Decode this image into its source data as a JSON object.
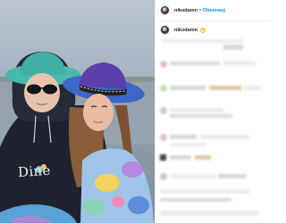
{
  "header": {
    "username": "nikodamn",
    "separator": "•",
    "follow_label": "Obserwuj"
  },
  "caption": {
    "username": "nikodamn"
  },
  "photo": {
    "hoodie_text": "Dine"
  },
  "colors": {
    "accent": "#0095f6",
    "verified_badge": "#f0c33c"
  }
}
